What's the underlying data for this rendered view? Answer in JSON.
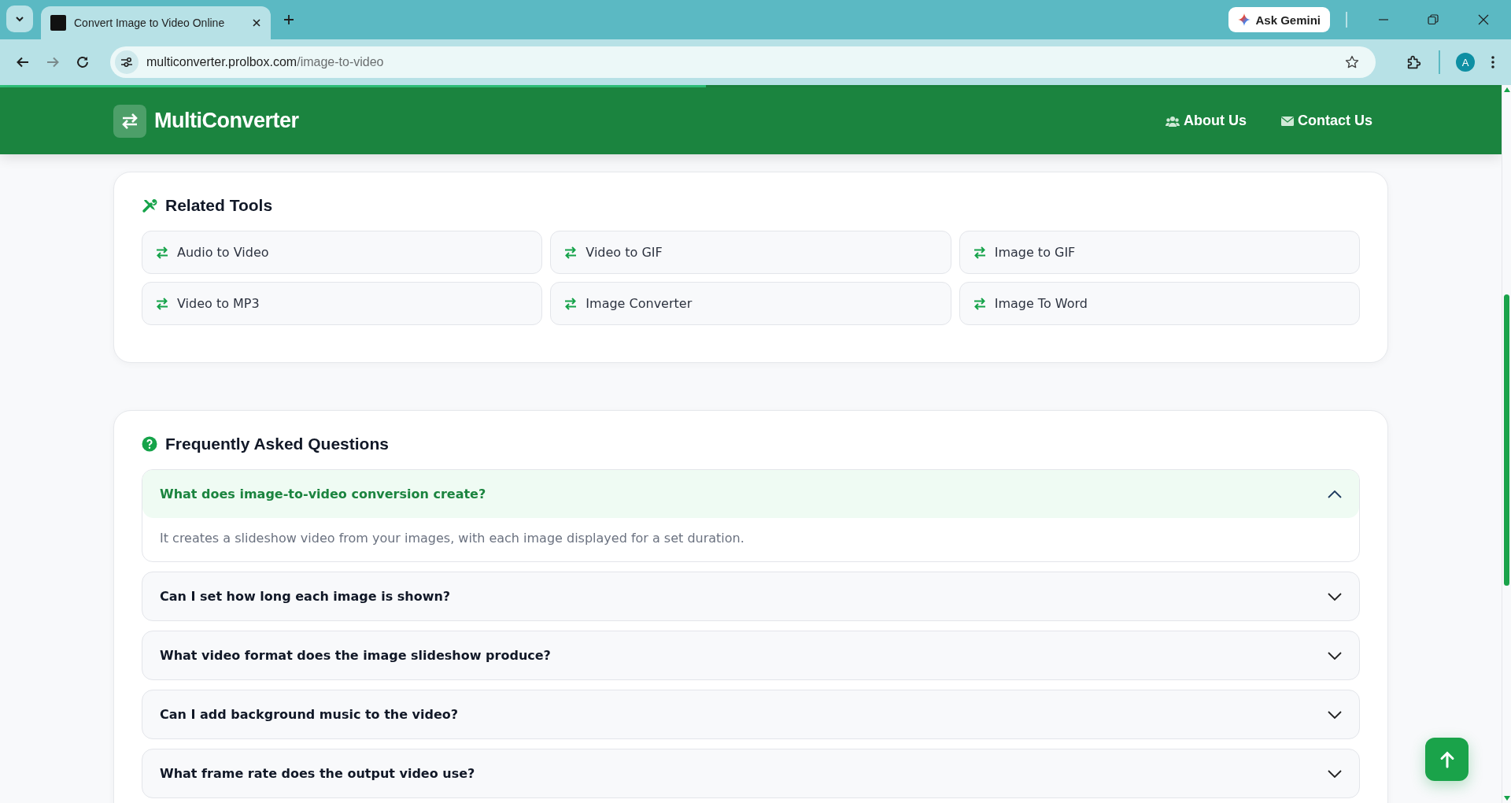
{
  "browser": {
    "tab": {
      "title": "Convert Image to Video Online",
      "selected": true
    },
    "gemini_button": "Ask Gemini",
    "url": {
      "host": "multiconverter.prolbox.com",
      "path": "/image-to-video"
    },
    "profile_initial": "A",
    "load_progress": {
      "level": 0.47
    }
  },
  "header": {
    "logo": "MultiConverter",
    "nav": [
      {
        "label": "About Us",
        "kind": "people"
      },
      {
        "label": "Contact Us",
        "kind": "mail"
      }
    ]
  },
  "related_tools": {
    "title": "Related Tools",
    "items": [
      "Audio to Video",
      "Video to GIF",
      "Image to GIF",
      "Video to MP3",
      "Image Converter",
      "Image To Word"
    ]
  },
  "faq": {
    "title": "Frequently Asked Questions",
    "items": [
      {
        "question": "What does image-to-video conversion create?",
        "expanded": true,
        "answer": "It creates a slideshow video from your images, with each image displayed for a set duration."
      },
      {
        "question": "Can I set how long each image is shown?",
        "expanded": false
      },
      {
        "question": "What video format does the image slideshow produce?",
        "expanded": false
      },
      {
        "question": "Can I add background music to the video?",
        "expanded": false
      },
      {
        "question": "What frame rate does the output video use?",
        "expanded": false
      }
    ]
  }
}
